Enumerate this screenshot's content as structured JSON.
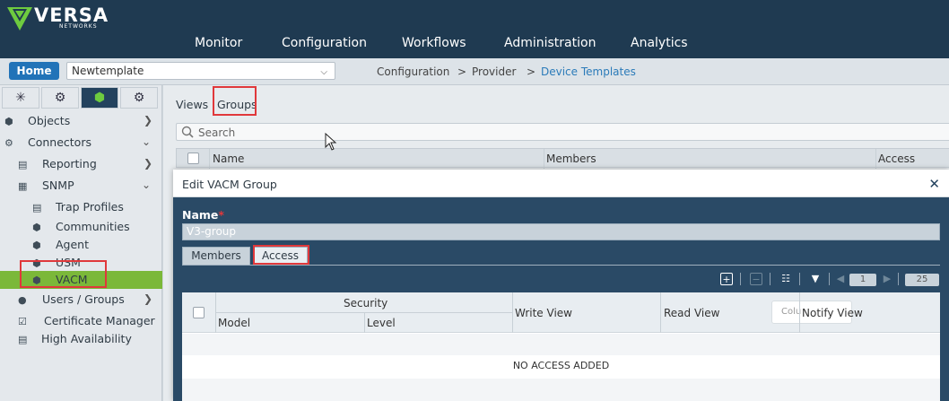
{
  "brand": {
    "name": "VERSA",
    "sub": "NETWORKS",
    "accent": "#6ecb3f",
    "header_bg": "#1f3a51"
  },
  "main_nav": [
    "Monitor",
    "Configuration",
    "Workflows",
    "Administration",
    "Analytics"
  ],
  "subbar": {
    "home_label": "Home",
    "template_value": "Newtemplate",
    "breadcrumb": [
      "Configuration",
      ">",
      "Provider",
      ">",
      "Device Templates"
    ]
  },
  "sidebar": {
    "tab_icons": [
      "network-icon",
      "gear-icon",
      "cube-icon",
      "gears-icon"
    ],
    "items": [
      {
        "label": "Objects",
        "icon": "cube-icon"
      },
      {
        "label": "Connectors",
        "icon": "gears-icon"
      },
      {
        "label": "Reporting",
        "icon": "chart-icon"
      },
      {
        "label": "SNMP",
        "icon": "grid-icon"
      },
      {
        "label": "Trap Profiles",
        "icon": "document-icon"
      },
      {
        "label": "Communities",
        "icon": "cube-icon"
      },
      {
        "label": "Agent",
        "icon": "cube-icon"
      },
      {
        "label": "USM",
        "icon": "cube-icon"
      },
      {
        "label": "VACM",
        "icon": "cube-icon"
      },
      {
        "label": "Users / Groups",
        "icon": "users-icon"
      },
      {
        "label": "Certificate Manager",
        "icon": "certificate-icon"
      },
      {
        "label": "High Availability",
        "icon": "server-icon"
      }
    ]
  },
  "content": {
    "tabs": [
      "Views",
      "Groups"
    ],
    "search_placeholder": "Search",
    "columns": [
      "Name",
      "Members",
      "Access"
    ]
  },
  "modal": {
    "title": "Edit VACM Group",
    "name_label": "Name",
    "required_mark": "*",
    "name_value": "V3-group",
    "tabs": [
      "Members",
      "Access"
    ],
    "pager": {
      "page": "1",
      "page_size": "25"
    },
    "table": {
      "security_header": "Security",
      "model_header": "Model",
      "level_header": "Level",
      "write_view_header": "Write View",
      "read_view_header": "Read View",
      "notify_view_header": "Notify View",
      "columns_button": "Colu",
      "empty_message": "NO ACCESS ADDED"
    }
  }
}
